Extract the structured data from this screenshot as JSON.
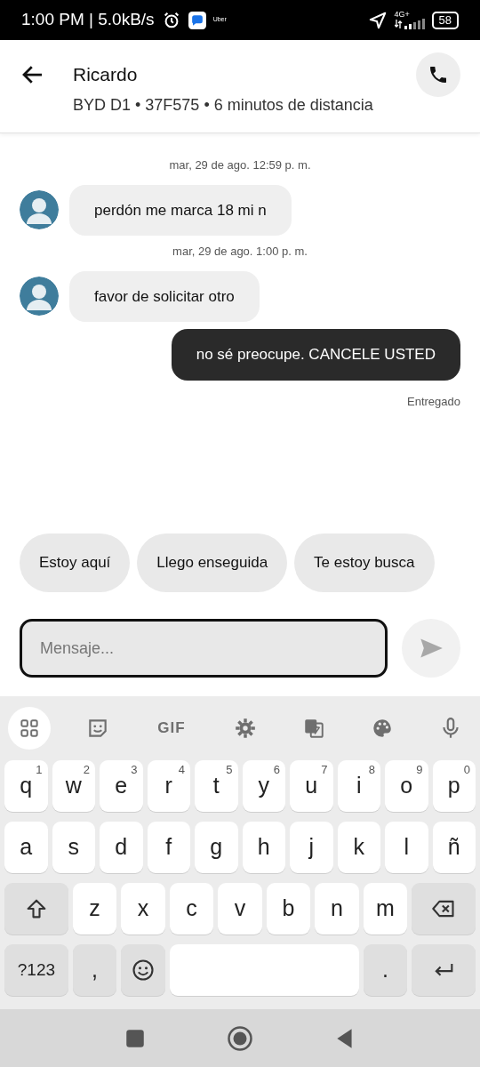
{
  "status_bar": {
    "time_speed": "1:00 PM | 5.0kB/s",
    "app_label": "Uber",
    "network": "4G+",
    "battery": "58"
  },
  "header": {
    "name": "Ricardo",
    "subtitle": "BYD D1 • 37F575 • 6 minutos de distancia"
  },
  "messages": [
    {
      "kind": "timestamp",
      "text": "mar, 29 de ago. 12:59 p. m."
    },
    {
      "kind": "incoming",
      "text": "perdón me marca 18 mi n"
    },
    {
      "kind": "timestamp",
      "text": "mar, 29 de ago. 1:00 p. m."
    },
    {
      "kind": "incoming",
      "text": "favor de solicitar otro"
    },
    {
      "kind": "outgoing",
      "text": "no sé preocupe. CANCELE USTED"
    },
    {
      "kind": "status",
      "text": "Entregado"
    }
  ],
  "quick_replies": [
    "Estoy aquí",
    "Llego enseguida",
    "Te estoy busca"
  ],
  "composer": {
    "placeholder": "Mensaje..."
  },
  "keyboard": {
    "gif_label": "GIF",
    "rows": [
      [
        {
          "kind": "letter",
          "label": "q",
          "hint": "1"
        },
        {
          "kind": "letter",
          "label": "w",
          "hint": "2"
        },
        {
          "kind": "letter",
          "label": "e",
          "hint": "3"
        },
        {
          "kind": "letter",
          "label": "r",
          "hint": "4"
        },
        {
          "kind": "letter",
          "label": "t",
          "hint": "5"
        },
        {
          "kind": "letter",
          "label": "y",
          "hint": "6"
        },
        {
          "kind": "letter",
          "label": "u",
          "hint": "7"
        },
        {
          "kind": "letter",
          "label": "i",
          "hint": "8"
        },
        {
          "kind": "letter",
          "label": "o",
          "hint": "9"
        },
        {
          "kind": "letter",
          "label": "p",
          "hint": "0"
        }
      ],
      [
        {
          "kind": "letter",
          "label": "a"
        },
        {
          "kind": "letter",
          "label": "s"
        },
        {
          "kind": "letter",
          "label": "d"
        },
        {
          "kind": "letter",
          "label": "f"
        },
        {
          "kind": "letter",
          "label": "g"
        },
        {
          "kind": "letter",
          "label": "h"
        },
        {
          "kind": "letter",
          "label": "j"
        },
        {
          "kind": "letter",
          "label": "k"
        },
        {
          "kind": "letter",
          "label": "l"
        },
        {
          "kind": "letter",
          "label": "ñ"
        }
      ],
      [
        {
          "kind": "shift"
        },
        {
          "kind": "letter",
          "label": "z"
        },
        {
          "kind": "letter",
          "label": "x"
        },
        {
          "kind": "letter",
          "label": "c"
        },
        {
          "kind": "letter",
          "label": "v"
        },
        {
          "kind": "letter",
          "label": "b"
        },
        {
          "kind": "letter",
          "label": "n"
        },
        {
          "kind": "letter",
          "label": "m"
        },
        {
          "kind": "backspace"
        }
      ],
      [
        {
          "kind": "symbols",
          "label": "?123"
        },
        {
          "kind": "punct",
          "label": ","
        },
        {
          "kind": "emoji"
        },
        {
          "kind": "space"
        },
        {
          "kind": "punct",
          "label": "."
        },
        {
          "kind": "enter"
        }
      ]
    ]
  }
}
